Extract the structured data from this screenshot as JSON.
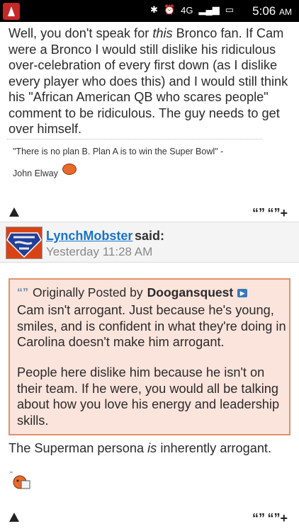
{
  "status_bar": {
    "time": "5:06",
    "ampm": "AM",
    "network": "4G",
    "icons": [
      "bluetooth-icon",
      "alarm-icon",
      "signal-icon",
      "battery-icon"
    ]
  },
  "post1": {
    "body_pre": "Well, you don't speak for ",
    "body_em": "this",
    "body_post": " Bronco fan. If Cam were a Bronco I would still dislike his ridiculous over-celebration of every first down (as I dislike every player who does this) and I would still think his \"African American QB who scares people\" comment to be ridiculous. The guy needs to get over himself.",
    "signature_quote": "\"There is no plan B. Plan A is to win the Super Bowl\" -",
    "signature_author": "John Elway"
  },
  "post2": {
    "username": "LynchMobster",
    "said": "said:",
    "timestamp": "Yesterday 11:28 AM",
    "quote": {
      "prefix": "Originally Posted by",
      "author": "Doogansquest",
      "paragraph1": "Cam isn't arrogant. Just because he's young, smiles, and is confident in what they're doing in Carolina doesn't make him arrogant.",
      "paragraph2": "People here dislike him because he isn't on their team. If he were, you would all be talking about how you love his energy and leadership skills."
    },
    "reply_pre": "The Superman persona ",
    "reply_em": "is",
    "reply_post": " inherently arrogant.",
    "small_quote_mark": "“"
  },
  "toolbar": {
    "quote_symbol": "“”",
    "multiquote_symbol": "“”+"
  },
  "colors": {
    "username": "#1a73c9",
    "quote_bg": "#fbe4dc",
    "quote_border": "#e0906f"
  }
}
